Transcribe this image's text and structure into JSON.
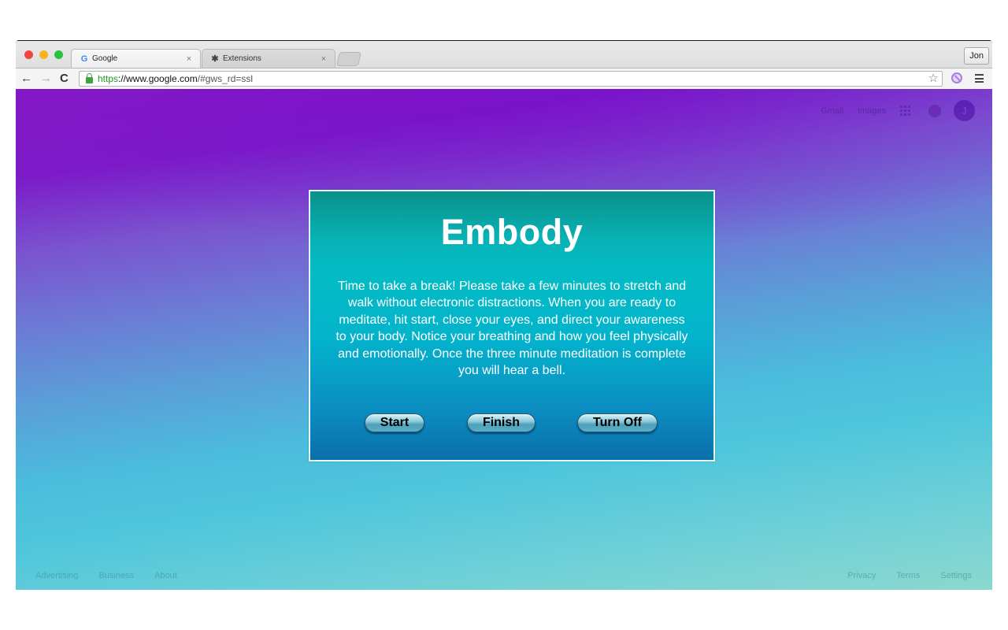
{
  "browser": {
    "tabs": [
      {
        "title": "Google",
        "favicon": "google-g-icon",
        "active": true
      },
      {
        "title": "Extensions",
        "favicon": "puzzle-piece-icon",
        "active": false
      }
    ],
    "profile_name": "Jon",
    "address_bar": {
      "scheme": "https",
      "host": "://www.google.com",
      "rest": "/#gws_rd=ssl"
    },
    "icons": {
      "back": "←",
      "forward": "→",
      "reload": "C",
      "star": "☆",
      "close": "×",
      "google_g": "G",
      "puzzle": "✱"
    }
  },
  "page": {
    "top_links": [
      "Gmail",
      "Images"
    ],
    "avatar_letter": "J",
    "footer_left": [
      "Advertising",
      "Business",
      "About"
    ],
    "footer_right": [
      "Privacy",
      "Terms",
      "Settings"
    ]
  },
  "modal": {
    "title": "Embody",
    "message": "Time to take a break! Please take a few minutes to stretch and walk without electronic distractions. When you are ready to meditate, hit start, close your eyes, and direct your awareness to your body. Notice your breathing and how you feel physically and emotionally. Once the three minute meditation is complete you will hear a bell.",
    "buttons": {
      "start": "Start",
      "finish": "Finish",
      "turn_off": "Turn Off"
    }
  },
  "colors": {
    "page_top": "#8418c6",
    "page_bottom": "#8bd8cf",
    "modal_top": "#0ea4a0",
    "modal_bottom": "#0a6faa",
    "secure_url": "#1f9c1f"
  }
}
